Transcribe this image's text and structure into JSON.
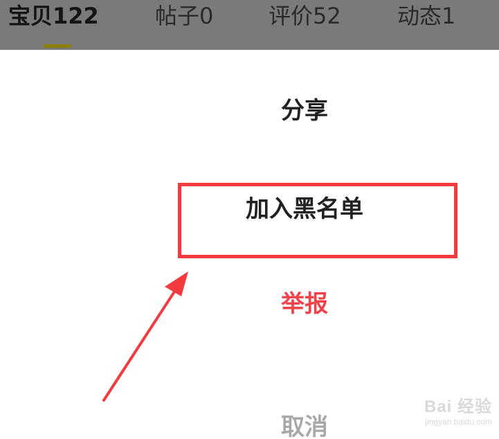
{
  "tabs": [
    {
      "label": "宝贝",
      "count": "122"
    },
    {
      "label": "帖子",
      "count": "0"
    },
    {
      "label": "评价",
      "count": "52"
    },
    {
      "label": "动态",
      "count": "1"
    }
  ],
  "action_sheet": {
    "share": "分享",
    "blacklist": "加入黑名单",
    "report": "举报",
    "cancel": "取消"
  },
  "colors": {
    "report": "#f0424a",
    "highlight": "#f23a3f",
    "tab_indicator": "#8f7f00"
  },
  "watermark": {
    "logo": "Bai 经验",
    "url": "jingyan.baidu.com"
  }
}
